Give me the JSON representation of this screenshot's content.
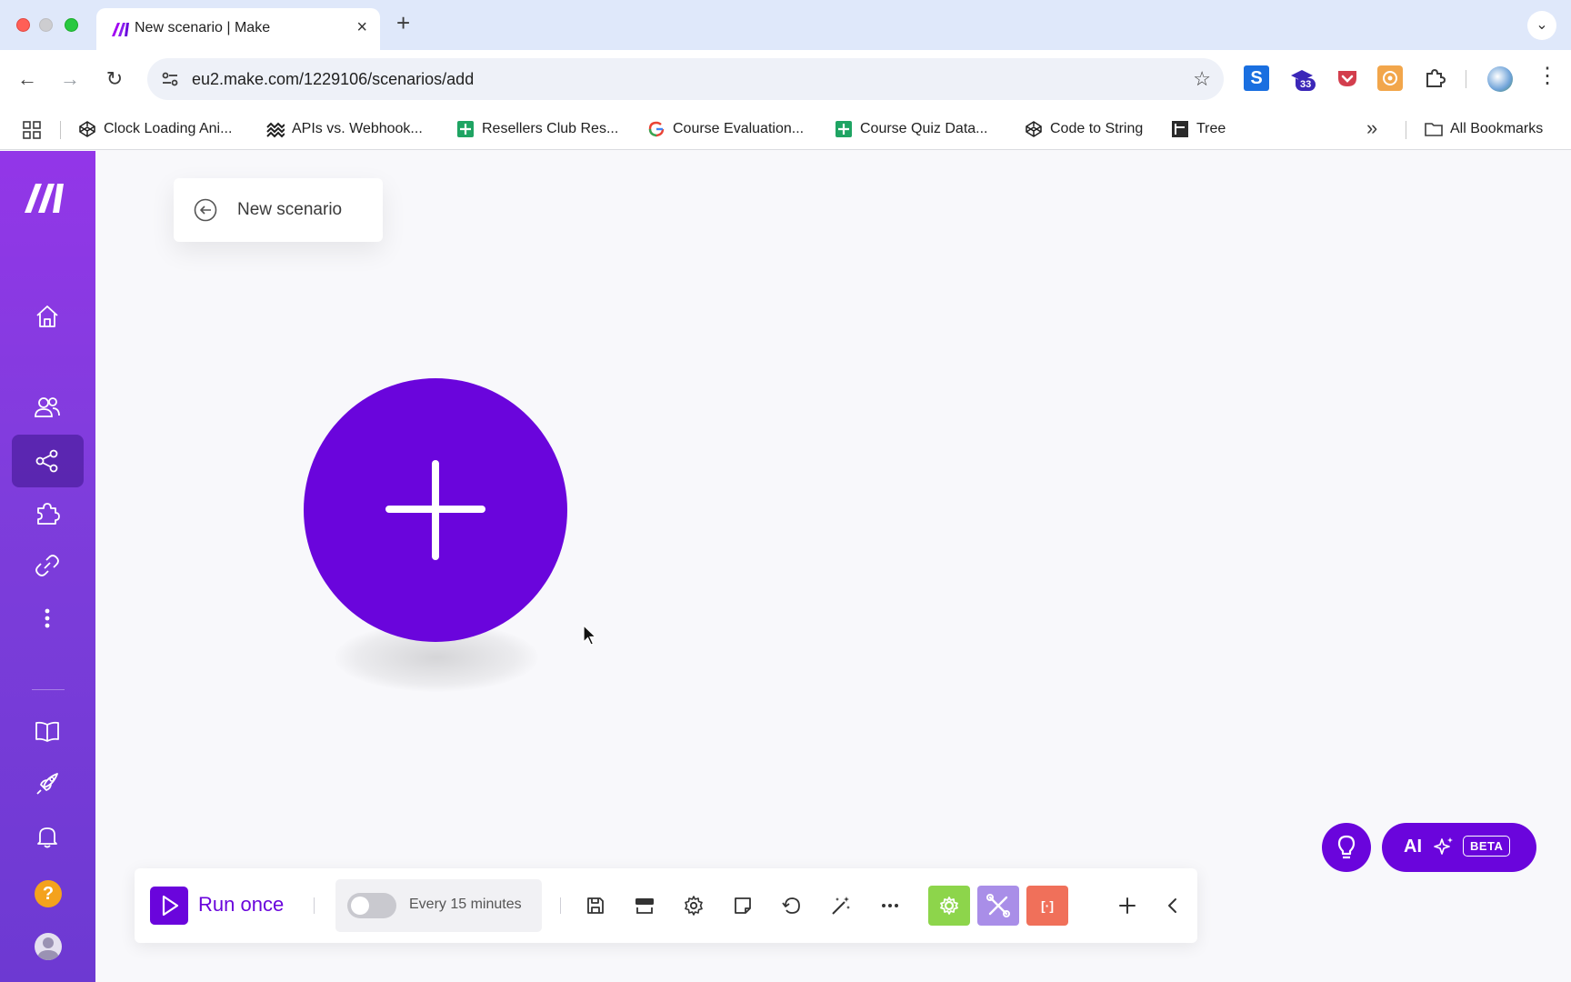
{
  "browser": {
    "tab_title": "New scenario | Make",
    "url": "eu2.make.com/1229106/scenarios/add",
    "extension_badge": "33",
    "bookmarks": [
      {
        "label": "Clock Loading Ani...",
        "icon": "codepen-icon"
      },
      {
        "label": "APIs vs. Webhook...",
        "icon": "stripes-icon"
      },
      {
        "label": "Resellers Club Res...",
        "icon": "sheets-icon"
      },
      {
        "label": "Course Evaluation...",
        "icon": "google-icon"
      },
      {
        "label": "Course Quiz Data...",
        "icon": "sheets-icon"
      },
      {
        "label": "Code to String",
        "icon": "codepen-icon"
      },
      {
        "label": "Tree",
        "icon": "tree-icon"
      }
    ],
    "all_bookmarks_label": "All Bookmarks"
  },
  "sidebar": {
    "items": [
      "home-icon",
      "team-icon",
      "scenarios-icon",
      "apps-icon",
      "connections-icon",
      "more-icon",
      "docs-icon",
      "rocket-icon",
      "notifications-icon",
      "help-icon",
      "avatar"
    ],
    "active": "scenarios-icon",
    "help_glyph": "?"
  },
  "canvas": {
    "scenario_name": "New scenario",
    "ai_label": "AI",
    "ai_badge": "BETA"
  },
  "bottom_toolbar": {
    "run_label": "Run once",
    "schedule_label": "Every 15 minutes",
    "schedule_enabled": false,
    "tools": [
      "save-icon",
      "import-icon",
      "settings-icon",
      "notes-icon",
      "undo-icon",
      "auto-align-icon",
      "more-icon"
    ],
    "tool_blocks": [
      "flow-control-icon",
      "tools-icon",
      "text-parser-icon"
    ],
    "text_parser_glyph": "[·]"
  },
  "colors": {
    "brand": "#6a05dc",
    "sidebar_top": "#9336e8",
    "flow_green": "#8dd54b",
    "tools_purple": "#a98ee8",
    "parser_orange": "#f0705a"
  }
}
